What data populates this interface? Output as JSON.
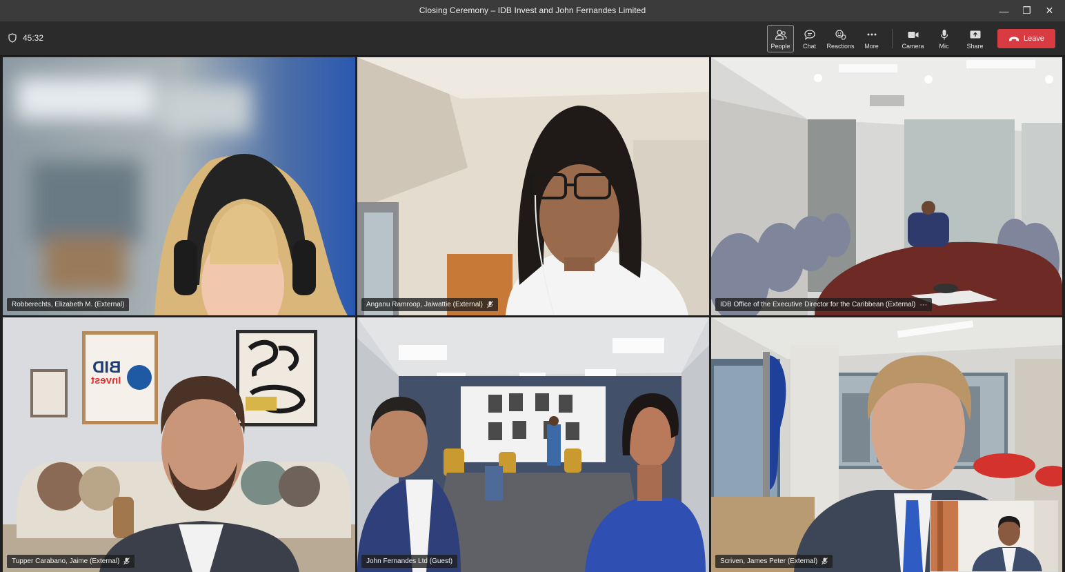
{
  "window": {
    "title": "Closing Ceremony – IDB Invest and John Fernandes Limited",
    "controls": [
      "—",
      "❐",
      "✕"
    ]
  },
  "toolbar": {
    "timer": "45:32",
    "buttons": {
      "people": "People",
      "chat": "Chat",
      "reactions": "Reactions",
      "more": "More",
      "camera": "Camera",
      "mic": "Mic",
      "share": "Share"
    },
    "leave_label": "Leave",
    "colors": {
      "leave": "#d83b42",
      "bar": "#2b2b2b"
    }
  },
  "participants": [
    {
      "name": "Robberechts, Elizabeth M. (External)",
      "muted": false
    },
    {
      "name": "Anganu Ramroop, Jaiwattie (External)",
      "muted": true
    },
    {
      "name": "IDB Office of the Executive Director for the Caribbean (External)",
      "muted": false,
      "more": "···"
    },
    {
      "name": "Tupper Carabano, Jaime (External)",
      "muted": true
    },
    {
      "name": "John Fernandes Ltd (Guest)",
      "muted": false
    },
    {
      "name": "Scriven, James Peter (External)",
      "muted": true
    }
  ],
  "background_logo": {
    "line1": "BID",
    "line2": "Invest"
  }
}
